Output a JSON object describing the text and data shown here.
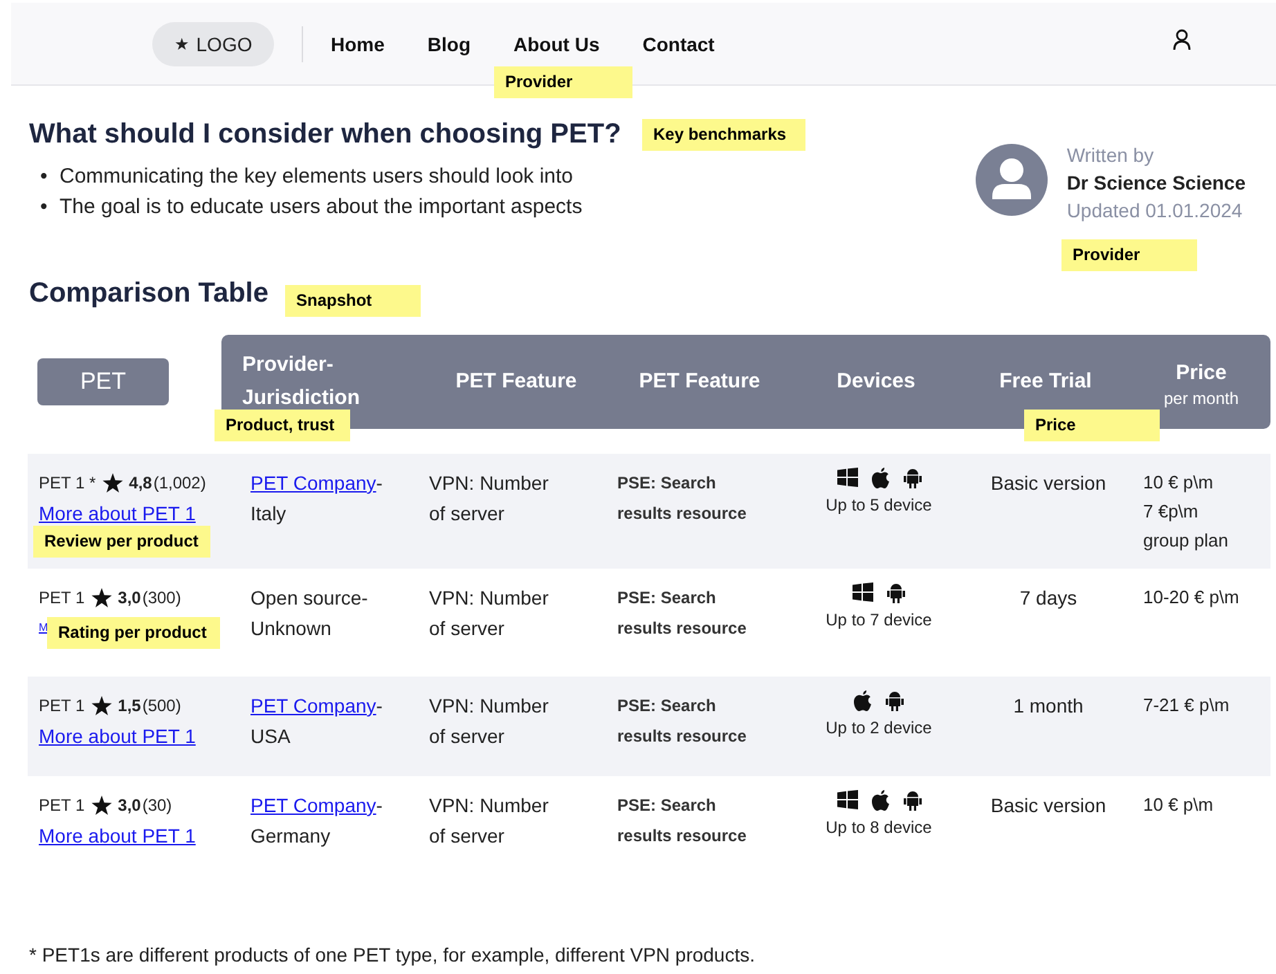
{
  "nav": {
    "logo": {
      "mark": "★",
      "text": "LOGO"
    },
    "links": [
      "Home",
      "Blog",
      "About Us",
      "Contact"
    ]
  },
  "intro": {
    "title": "What should I consider when choosing PET?",
    "bullets": [
      {
        "marker": "•",
        "text": "Communicating the key elements users should look into"
      },
      {
        "marker": "•",
        "text": "The goal is to educate users about the important aspects"
      }
    ]
  },
  "author": {
    "written_by": "Written by",
    "name": "Dr Science Science",
    "updated": "Updated 01.01.2024"
  },
  "comparison": {
    "title": "Comparison Table",
    "first_column": "PET",
    "columns": [
      {
        "label": "Provider-Jurisdiction"
      },
      {
        "label": "PET Feature"
      },
      {
        "label": "PET Feature"
      },
      {
        "label": "Devices"
      },
      {
        "label": "Free Trial"
      },
      {
        "label": "Price",
        "sub": "per month"
      }
    ],
    "rows": [
      {
        "name": "PET 1 *",
        "score": "4,8",
        "count": "(1,002)",
        "more": "More about PET 1",
        "provider": {
          "name": "PET Company",
          "linked": true,
          "dash": "-"
        },
        "jurisdiction": "Italy",
        "feature_1": "VPN: Number of server",
        "feature_2": "PSE: Search results resource",
        "platforms": [
          {
            "kind": "windows"
          },
          {
            "kind": "apple"
          },
          {
            "kind": "android"
          }
        ],
        "devices": "Up to 5 device",
        "trial": "Basic version",
        "price": [
          "10 € p\\m",
          "7 €p\\m",
          "group plan"
        ]
      },
      {
        "name": "PET 1",
        "score": "3,0",
        "count": "(300)",
        "more": "M",
        "provider": {
          "name": "Open source",
          "linked": false,
          "dash": "-"
        },
        "jurisdiction": "Unknown",
        "feature_1": "VPN: Number of server",
        "feature_2": "PSE: Search results resource",
        "platforms": [
          {
            "kind": "windows"
          },
          {
            "kind": "android"
          }
        ],
        "devices": "Up to 7 device",
        "trial": "7 days",
        "price": [
          "10-20 € p\\m"
        ]
      },
      {
        "name": "PET 1",
        "score": "1,5",
        "count": "(500)",
        "more": "More about PET 1",
        "provider": {
          "name": "PET Company",
          "linked": true,
          "dash": "-"
        },
        "jurisdiction": "USA",
        "feature_1": "VPN: Number of server",
        "feature_2": "PSE: Search results resource",
        "platforms": [
          {
            "kind": "apple"
          },
          {
            "kind": "android"
          }
        ],
        "devices": "Up to 2 device",
        "trial": "1 month",
        "price": [
          "7-21 € p\\m"
        ]
      },
      {
        "name": "PET 1",
        "score": "3,0",
        "count": "(30)",
        "more": "More about PET 1",
        "provider": {
          "name": "PET Company",
          "linked": true,
          "dash": "-"
        },
        "jurisdiction": "Germany",
        "feature_1": "VPN: Number of server",
        "feature_2": "PSE: Search results resource",
        "platforms": [
          {
            "kind": "windows"
          },
          {
            "kind": "apple"
          },
          {
            "kind": "android"
          }
        ],
        "devices": "Up to 8 device",
        "trial": "Basic version",
        "price": [
          "10 € p\\m"
        ]
      }
    ]
  },
  "footnote": "* PET1s are different products of one PET type, for example, different VPN products.",
  "notes": [
    "Provider",
    "Key benchmarks",
    "Provider",
    "Snapshot",
    "Product, trust",
    "Price",
    "Review per product",
    "Rating per product"
  ]
}
